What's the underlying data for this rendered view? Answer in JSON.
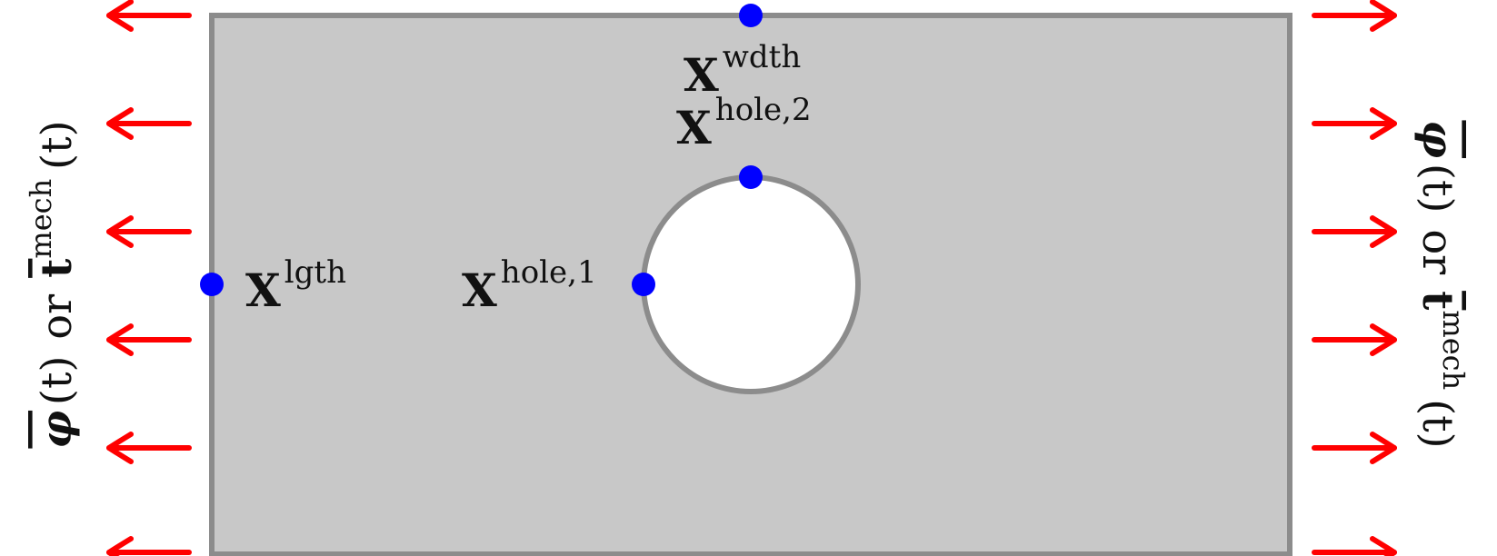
{
  "colors": {
    "plate_fill": "#c8c8c8",
    "plate_stroke": "#8c8c8c",
    "hole_fill": "#ffffff",
    "arrow": "#ff0000",
    "point": "#0000ff",
    "text": "#111111"
  },
  "points": {
    "wdth": {
      "base": "X",
      "sup": "wdth"
    },
    "hole2": {
      "base": "X",
      "sup": "hole,2"
    },
    "lgth": {
      "base": "X",
      "sup": "lgth"
    },
    "hole1": {
      "base": "X",
      "sup": "hole,1"
    }
  },
  "boundary_label": {
    "phi": "φ",
    "t_arg": "(t)",
    "or": "or",
    "t": "t",
    "mech": "mech"
  },
  "arrows": {
    "left_direction": "left",
    "right_direction": "right",
    "count_per_side": 6
  }
}
